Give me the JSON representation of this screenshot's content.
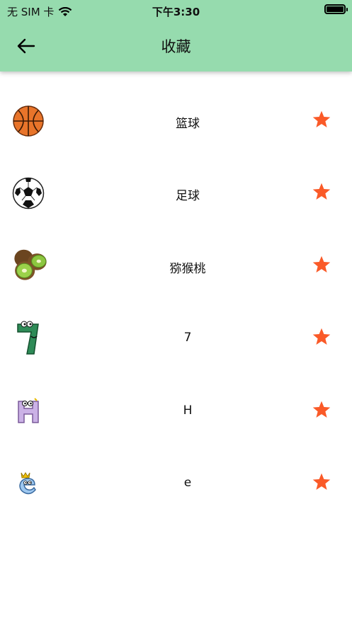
{
  "status_bar": {
    "carrier": "无 SIM 卡",
    "time": "下午3:30"
  },
  "header": {
    "title": "收藏",
    "back_icon": "arrow-left-icon"
  },
  "favorites": [
    {
      "label": "篮球",
      "icon": "basketball-icon"
    },
    {
      "label": "足球",
      "icon": "soccer-ball-icon"
    },
    {
      "label": "猕猴桃",
      "icon": "kiwi-icon"
    },
    {
      "label": "7",
      "icon": "number-seven-icon"
    },
    {
      "label": "H",
      "icon": "letter-h-icon"
    },
    {
      "label": "e",
      "icon": "letter-e-icon"
    }
  ],
  "colors": {
    "header_bg": "#96dbae",
    "star": "#fa5a28"
  }
}
